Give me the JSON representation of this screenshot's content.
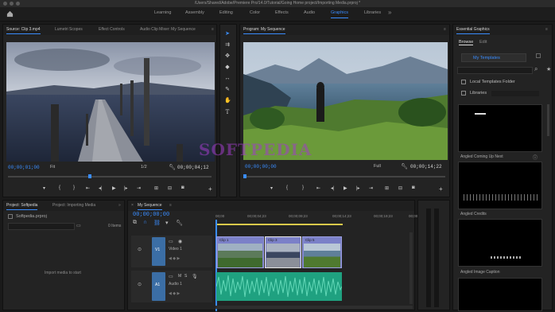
{
  "window": {
    "title": "/Users/Shared/Adobe/Premiere Pro/14.0/Tutorial/Going Home project/Importing Media.prproj *"
  },
  "workspaces": [
    {
      "label": "Learning"
    },
    {
      "label": "Assembly"
    },
    {
      "label": "Editing"
    },
    {
      "label": "Color"
    },
    {
      "label": "Effects"
    },
    {
      "label": "Audio"
    },
    {
      "label": "Graphics",
      "active": true
    },
    {
      "label": "Libraries"
    }
  ],
  "workspaces_more": "»",
  "source_monitor": {
    "tabs": [
      "Source: Clip 3.mp4",
      "Lumetri Scopes",
      "Effect Controls",
      "Audio Clip Mixer: My Sequence"
    ],
    "timecode_in": "00;00;01;00",
    "fit": "Fit",
    "fraction": "1/2",
    "timecode_out": "00;00;04;12"
  },
  "program_monitor": {
    "tab": "Program: My Sequence",
    "timecode_in": "00;00;00;00",
    "fit": "Full",
    "timecode_out": "00;00;14;22"
  },
  "essential_graphics": {
    "title": "Essential Graphics",
    "tabs": [
      "Browse",
      "Edit"
    ],
    "dropdown": "My Templates",
    "local_templates": "Local Templates Folder",
    "libraries": "Libraries",
    "templates": [
      {
        "label": "Angled Coming Up Next"
      },
      {
        "label": "Angled Credits"
      },
      {
        "label": "Angled Image Caption"
      }
    ]
  },
  "project": {
    "tabs": [
      "Project: Softpedia",
      "Project: Importing Media"
    ],
    "file": "Softpedia.prproj",
    "items": "0 Items",
    "import_hint": "Import media to start"
  },
  "timeline": {
    "tab": "My Sequence",
    "timecode": "00;00;00;00",
    "ruler": [
      "00;00",
      "00;00;04;23",
      "00;00;09;23",
      "00;00;14;23",
      "00;00;19;23",
      "00;00;24;23"
    ],
    "tracks": {
      "v1": "V1",
      "a1": "A1",
      "video_label": "Video 1",
      "audio_label": "Audio 1"
    },
    "clips": [
      {
        "name": "Clip 1"
      },
      {
        "name": "Clip 3"
      },
      {
        "name": "Clip 5"
      }
    ]
  },
  "watermark": "SOFTPEDIA",
  "colors": {
    "accent": "#3a8dff",
    "video_clip": "#7b80c8",
    "audio_clip": "#1fa180"
  }
}
